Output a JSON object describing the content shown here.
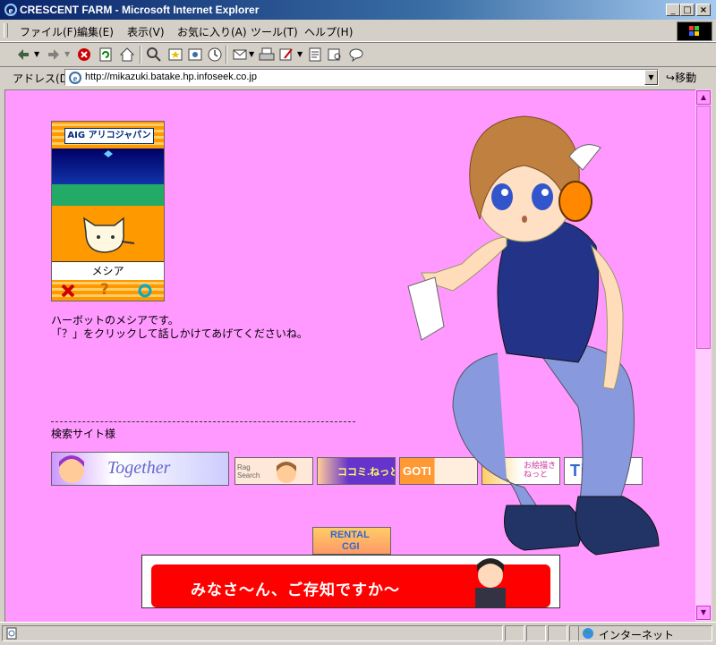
{
  "window": {
    "title": "CRESCENT FARM - Microsoft Internet Explorer",
    "min_icon": "minimize-icon",
    "max_icon": "maximize-icon",
    "close_icon": "close-icon"
  },
  "menu": {
    "items": [
      "ファイル(F)",
      "編集(E)",
      "表示(V)",
      "お気に入り(A)",
      "ツール(T)",
      "ヘルプ(H)"
    ]
  },
  "toolbar": {
    "icons": [
      "back-icon",
      "forward-icon",
      "stop-icon",
      "refresh-icon",
      "home-icon",
      "search-icon",
      "favorites-icon",
      "media-icon",
      "history-icon",
      "mail-icon",
      "print-icon",
      "edit-icon",
      "discuss-icon",
      "messenger-icon"
    ]
  },
  "address": {
    "label": "アドレス(D)",
    "url": "http://mikazuki.batake.hp.infoseek.co.jp",
    "go_label": "移動"
  },
  "page": {
    "bot_header": "AIG アリコジャパン",
    "bot_name": "メシア",
    "bot_buttons": [
      "close-icon",
      "help-icon",
      "talk-icon"
    ],
    "intro_line1": "ハーボットのメシアです。",
    "intro_line2": "「？」をクリックして話しかけてあげてくださいね。",
    "search_sites_label": "検索サイト様",
    "banners": [
      "Together",
      "Rag Search",
      "ココミ.ねっと",
      "GOTI",
      "お絵描きねっと",
      "Tinami"
    ],
    "rental_banner_line1": "RENTAL",
    "rental_banner_line2": "CGI",
    "ad_text": "みなさ～ん、ご存知ですか～"
  },
  "status": {
    "zone_label": "インターネット"
  },
  "colors": {
    "page_bg": "#ff99ff",
    "scroll_track": "#ffccff",
    "ad_red": "#ff0000",
    "titlebar_start": "#0a246a"
  }
}
